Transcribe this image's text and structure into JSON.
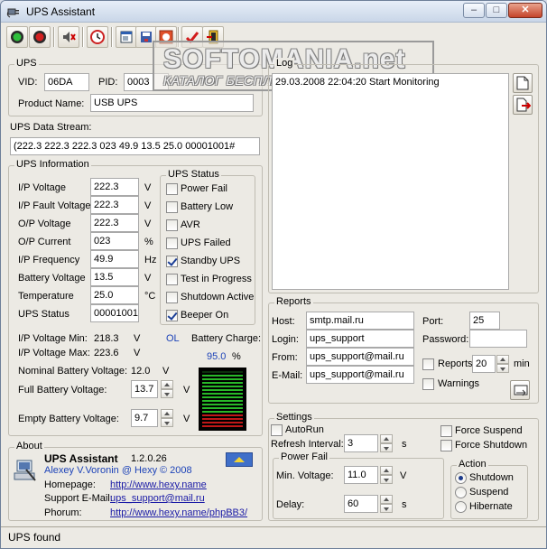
{
  "window": {
    "title": "UPS Assistant"
  },
  "toolbar": {
    "buttons": [
      "connect-icon",
      "disconnect-icon",
      "mute-icon",
      "clock-icon",
      "notepad-icon",
      "save-icon",
      "options-icon",
      "check-icon",
      "exit-icon"
    ]
  },
  "watermark": {
    "title": "SOFTOMANIA.net",
    "subtitle": "КАТАЛОГ БЕСПЛАТНЫХ ПРОГРАММ"
  },
  "ups": {
    "group_label": "UPS",
    "vid_label": "VID:",
    "vid": "06DA",
    "pid_label": "PID:",
    "pid": "0003",
    "product_label": "Product Name:",
    "product": "USB UPS",
    "stream_label": "UPS Data Stream:",
    "stream": "(222.3 222.3 222.3 023 49.9 13.5 25.0 00001001#"
  },
  "info": {
    "group_label": "UPS Information",
    "rows": [
      {
        "label": "I/P Voltage",
        "value": "222.3",
        "unit": "V"
      },
      {
        "label": "I/P Fault Voltage",
        "value": "222.3",
        "unit": "V"
      },
      {
        "label": "O/P Voltage",
        "value": "222.3",
        "unit": "V"
      },
      {
        "label": "O/P Current",
        "value": "023",
        "unit": "%"
      },
      {
        "label": "I/P Frequency",
        "value": "49.9",
        "unit": "Hz"
      },
      {
        "label": "Battery Voltage",
        "value": "13.5",
        "unit": "V"
      },
      {
        "label": "Temperature",
        "value": "25.0",
        "unit": "°C"
      },
      {
        "label": "UPS Status",
        "value": "00001001",
        "unit": ""
      }
    ],
    "status_group_label": "UPS Status",
    "status": [
      {
        "label": "Power Fail",
        "checked": false
      },
      {
        "label": "Battery Low",
        "checked": false
      },
      {
        "label": "AVR",
        "checked": false
      },
      {
        "label": "UPS Failed",
        "checked": false
      },
      {
        "label": "Standby UPS",
        "checked": true
      },
      {
        "label": "Test in Progress",
        "checked": false
      },
      {
        "label": "Shutdown Active",
        "checked": false
      },
      {
        "label": "Beeper On",
        "checked": true
      }
    ],
    "ipmin_label": "I/P Voltage Min:",
    "ipmin": "218.3",
    "ipmin_unit": "V",
    "ipmax_label": "I/P Voltage Max:",
    "ipmax": "223.6",
    "ipmax_unit": "V",
    "ol": "OL",
    "charge_label": "Battery Charge:",
    "charge": "95.0",
    "charge_unit": "%",
    "charge_fraction": 0.95,
    "nominal_label": "Nominal Battery Voltage:",
    "nominal": "12.0",
    "nominal_unit": "V",
    "full_label": "Full Battery Voltage:",
    "full": "13.7",
    "full_unit": "V",
    "empty_label": "Empty Battery Voltage:",
    "empty": "9.7",
    "empty_unit": "V"
  },
  "about": {
    "group_label": "About",
    "app": "UPS Assistant",
    "version": "1.2.0.26",
    "author": "Alexey V.Voronin @ Hexy",
    "year": "© 2008",
    "homepage_label": "Homepage:",
    "homepage": "http://www.hexy.name",
    "email_label": "Support E-Mail:",
    "email": "ups_support@mail.ru",
    "phorum_label": "Phorum:",
    "phorum": "http://www.hexy.name/phpBB3/"
  },
  "log": {
    "group_label": "Log",
    "entries": [
      "29.03.2008 22:04:20 Start Monitoring"
    ]
  },
  "reports": {
    "group_label": "Reports",
    "host_label": "Host:",
    "host": "smtp.mail.ru",
    "login_label": "Login:",
    "login": "ups_support",
    "from_label": "From:",
    "from": "ups_support@mail.ru",
    "email_label": "E-Mail:",
    "email": "ups_support@mail.ru",
    "port_label": "Port:",
    "port": "25",
    "password_label": "Password:",
    "password": "",
    "reports_label": "Reports",
    "reports_checked": false,
    "reports_min": "20",
    "min_label": "min",
    "warnings_label": "Warnings",
    "warnings_checked": false
  },
  "settings": {
    "group_label": "Settings",
    "autorun_label": "AutoRun",
    "autorun_checked": false,
    "refresh_label": "Refresh Interval:",
    "refresh": "3",
    "refresh_unit": "s",
    "force_suspend_label": "Force Suspend",
    "force_suspend_checked": false,
    "force_shutdown_label": "Force Shutdown",
    "force_shutdown_checked": false,
    "powerfail_label": "Power Fail",
    "minv_label": "Min. Voltage:",
    "minv": "11.0",
    "minv_unit": "V",
    "delay_label": "Delay:",
    "delay": "60",
    "delay_unit": "s",
    "action_label": "Action",
    "actions": [
      {
        "label": "Shutdown",
        "checked": true
      },
      {
        "label": "Suspend",
        "checked": false
      },
      {
        "label": "Hibernate",
        "checked": false
      }
    ]
  },
  "statusbar": {
    "text": "UPS found"
  }
}
